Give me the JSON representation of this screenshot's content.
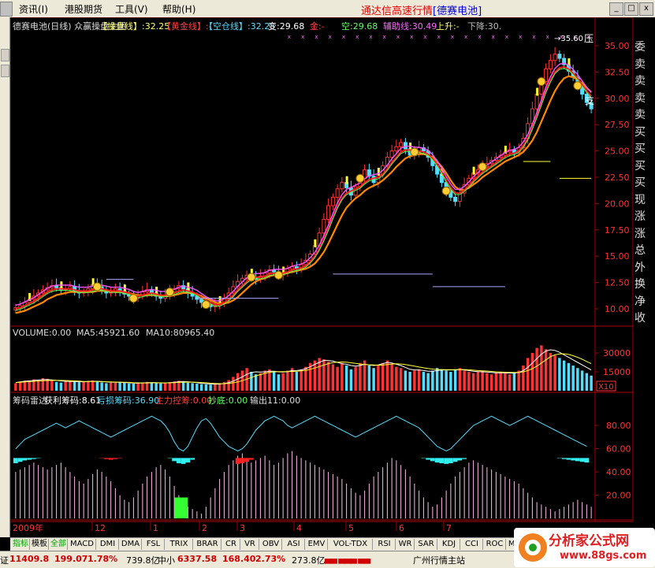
{
  "menu": {
    "items": [
      "资讯(I)",
      "港股期货",
      "工具(V)",
      "帮助(H)"
    ],
    "title_main": "通达信高速行情",
    "title_stock": "[德赛电池]"
  },
  "window_buttons": [
    "_",
    "□",
    "x"
  ],
  "price_panel": {
    "labels": [
      {
        "text": "德赛电池(日线) 众赢操盘主图",
        "color": "#dddddd"
      },
      {
        "text": "【操盘线】:32.25",
        "color": "#ffff66"
      },
      {
        "text": "【黄金线】:-",
        "color": "#ff4040"
      },
      {
        "text": "【空仓线】:32.25",
        "color": "#55ddff"
      },
      {
        "text": "变:29.68",
        "color": "#ffffff"
      },
      {
        "text": "金:-",
        "color": "#ff4040"
      },
      {
        "text": "空:29.68",
        "color": "#66ff66"
      },
      {
        "text": "辅助线:30.49",
        "color": "#ff66ff"
      },
      {
        "text": "上升:-",
        "color": "#ffff66"
      },
      {
        "text": "下降:30.",
        "color": "#bbbbbb"
      }
    ],
    "axis_ticks": [
      "35.00",
      "32.50",
      "30.00",
      "27.50",
      "25.00",
      "22.50",
      "20.00",
      "17.50",
      "15.00",
      "12.50",
      "10.00"
    ],
    "annotations": [
      "35.60",
      "压",
      "支"
    ]
  },
  "right_panel": [
    "委",
    "卖",
    "卖",
    "卖",
    "卖",
    "买",
    "买",
    "买",
    "买",
    "现",
    "涨",
    "涨",
    "总",
    "外",
    "换",
    "净",
    "收"
  ],
  "volume_panel": {
    "labels": [
      {
        "text": "VOLUME:0.00",
        "color": "#dddddd"
      },
      {
        "text": "MA5:45921.60",
        "color": "#dddddd"
      },
      {
        "text": "MA10:80965.40",
        "color": "#dddddd"
      }
    ],
    "axis_ticks": [
      "30000",
      "15000"
    ],
    "unit": "X10"
  },
  "osc_panel": {
    "labels": [
      {
        "text": "筹码雷达",
        "color": "#dddddd"
      },
      {
        "text": "获利筹码:8.61",
        "color": "#ffffff"
      },
      {
        "text": "亏损筹码:36.90",
        "color": "#55ddff"
      },
      {
        "text": "主力控筹:0.00",
        "color": "#ff4040"
      },
      {
        "text": "抄底:0.00",
        "color": "#66ff66"
      },
      {
        "text": "输出11:0.00",
        "color": "#dddddd"
      }
    ],
    "axis_ticks": [
      "80.00",
      "60.00",
      "40.00",
      "20.00"
    ]
  },
  "date_axis": [
    "2009年",
    "12",
    "1",
    "2",
    "3",
    "4",
    "5",
    "6",
    "7"
  ],
  "tabs": [
    "指标",
    "模板",
    "全部",
    "MACD",
    "DMI",
    "DMA",
    "FSL",
    "TRIX",
    "BRAR",
    "CR",
    "VR",
    "OBV",
    "ASI",
    "EMV",
    "VOL-TDX",
    "RSI",
    "WR",
    "SAR",
    "KDJ",
    "CCI",
    "ROC",
    "MTM"
  ],
  "status": {
    "index1_name": "证",
    "index1_value": "11409.8",
    "index1_change": "199.07",
    "index1_pct": "1.78%",
    "index1_amount": "739.8亿",
    "index2_name": "中小",
    "index2_value": "6337.58",
    "index2_change": "168.40",
    "index2_pct": "2.73%",
    "index2_amount": "273.8亿",
    "station": "广州行情主站"
  },
  "watermark": {
    "line1": "分析家公式网",
    "line2": "www.88gs.com"
  },
  "colors": {
    "up": "#ff3333",
    "down": "#55ddff",
    "ma_orange": "#ff8800",
    "ma_red": "#ff2020",
    "ma_magenta": "#ff55ff",
    "ma_green": "#55ff55",
    "accent_yellow": "#ffff33"
  },
  "chart_data": {
    "type": "candlestick",
    "price": {
      "ylim": [
        8.5,
        36.5
      ],
      "ticks": [
        10,
        12.5,
        15,
        17.5,
        20,
        22.5,
        25,
        27.5,
        30,
        32.5,
        35
      ],
      "close": [
        10.1,
        10.3,
        10.6,
        10.9,
        11.2,
        11.5,
        11.8,
        12.0,
        12.2,
        12.0,
        11.8,
        11.9,
        12.1,
        11.7,
        11.5,
        11.6,
        11.9,
        12.3,
        12.1,
        11.8,
        11.5,
        11.6,
        11.9,
        11.7,
        11.4,
        11.2,
        11.0,
        11.3,
        11.6,
        11.8,
        11.5,
        11.2,
        11.0,
        11.3,
        11.6,
        11.9,
        12.2,
        11.9,
        11.5,
        11.2,
        10.9,
        10.6,
        10.4,
        10.2,
        10.3,
        10.6,
        11.0,
        11.5,
        12.1,
        12.6,
        12.9,
        13.2,
        13.0,
        12.8,
        13.1,
        13.4,
        13.7,
        13.5,
        13.2,
        13.4,
        13.8,
        14.0,
        13.8,
        14.2,
        14.6,
        15.2,
        16.0,
        17.2,
        18.5,
        19.8,
        20.6,
        21.4,
        22.0,
        21.5,
        20.8,
        21.6,
        22.4,
        23.2,
        22.6,
        22.0,
        22.8,
        23.6,
        24.4,
        25.0,
        25.4,
        25.8,
        25.2,
        24.6,
        24.9,
        25.3,
        25.0,
        24.4,
        23.6,
        22.8,
        22.0,
        21.2,
        20.6,
        20.2,
        21.0,
        21.8,
        22.4,
        22.9,
        23.2,
        23.5,
        23.8,
        24.1,
        24.4,
        24.6,
        24.9,
        25.1,
        24.8,
        25.3,
        26.2,
        27.6,
        29.0,
        30.4,
        31.6,
        32.8,
        33.6,
        34.2,
        33.8,
        33.2,
        32.6,
        32.0,
        31.2,
        30.4,
        29.6,
        29.0
      ],
      "ma_fast": [
        10.0,
        10.1,
        10.3,
        10.5,
        10.7,
        11.0,
        11.3,
        11.6,
        11.8,
        11.9,
        11.9,
        11.9,
        11.9,
        11.8,
        11.7,
        11.7,
        11.7,
        11.8,
        11.9,
        11.9,
        11.8,
        11.7,
        11.7,
        11.7,
        11.6,
        11.5,
        11.3,
        11.2,
        11.3,
        11.4,
        11.5,
        11.4,
        11.3,
        11.3,
        11.4,
        11.5,
        11.7,
        11.8,
        11.7,
        11.6,
        11.4,
        11.1,
        10.8,
        10.6,
        10.4,
        10.4,
        10.6,
        10.9,
        11.3,
        11.8,
        12.2,
        12.6,
        12.9,
        13.0,
        13.0,
        13.1,
        13.3,
        13.4,
        13.4,
        13.4,
        13.5,
        13.7,
        13.8,
        13.9,
        14.1,
        14.5,
        15.0,
        15.7,
        16.6,
        17.6,
        18.7,
        19.7,
        20.5,
        21.0,
        21.2,
        21.4,
        21.6,
        22.0,
        22.3,
        22.4,
        22.5,
        22.8,
        23.3,
        23.9,
        24.4,
        24.9,
        25.1,
        25.1,
        25.0,
        25.0,
        24.9,
        24.7,
        24.3,
        23.7,
        23.0,
        22.2,
        21.5,
        21.0,
        21.0,
        21.3,
        21.7,
        22.2,
        22.6,
        23.0,
        23.3,
        23.6,
        23.9,
        24.2,
        24.5,
        24.7,
        24.8,
        25.0,
        25.5,
        26.2,
        27.2,
        28.3,
        29.5,
        30.7,
        31.7,
        32.5,
        32.9,
        33.0,
        32.8,
        32.4,
        31.9,
        31.3,
        30.7,
        30.2
      ],
      "ma_slow": [
        9.6,
        9.7,
        9.8,
        10.0,
        10.2,
        10.4,
        10.6,
        10.9,
        11.1,
        11.3,
        11.4,
        11.5,
        11.6,
        11.6,
        11.6,
        11.6,
        11.6,
        11.6,
        11.7,
        11.7,
        11.7,
        11.7,
        11.6,
        11.6,
        11.6,
        11.5,
        11.4,
        11.3,
        11.3,
        11.3,
        11.3,
        11.3,
        11.2,
        11.2,
        11.2,
        11.3,
        11.4,
        11.5,
        11.5,
        11.5,
        11.4,
        11.2,
        11.0,
        10.8,
        10.6,
        10.5,
        10.5,
        10.6,
        10.8,
        11.1,
        11.5,
        11.9,
        12.3,
        12.6,
        12.8,
        12.9,
        13.1,
        13.2,
        13.3,
        13.3,
        13.4,
        13.5,
        13.6,
        13.7,
        13.8,
        14.0,
        14.3,
        14.8,
        15.4,
        16.2,
        17.1,
        18.0,
        18.9,
        19.6,
        20.1,
        20.5,
        20.8,
        21.2,
        21.5,
        21.7,
        21.9,
        22.2,
        22.6,
        23.0,
        23.5,
        23.9,
        24.3,
        24.5,
        24.6,
        24.7,
        24.7,
        24.6,
        24.4,
        24.0,
        23.5,
        22.9,
        22.2,
        21.6,
        21.3,
        21.3,
        21.5,
        21.8,
        22.1,
        22.5,
        22.8,
        23.1,
        23.4,
        23.7,
        24.0,
        24.2,
        24.4,
        24.6,
        24.9,
        25.4,
        26.0,
        26.8,
        27.8,
        28.8,
        29.8,
        30.7,
        31.4,
        31.9,
        32.1,
        32.0,
        31.8,
        31.4,
        31.0,
        30.6
      ]
    },
    "volume": {
      "ylim": [
        0,
        40000
      ],
      "ticks": [
        15000,
        30000
      ],
      "values": [
        6000,
        7000,
        8000,
        7500,
        9000,
        8500,
        10000,
        9500,
        8000,
        7000,
        6500,
        7200,
        8000,
        7600,
        6800,
        7000,
        7800,
        8200,
        7400,
        6600,
        6000,
        6400,
        7000,
        6800,
        6200,
        5800,
        5600,
        6000,
        6600,
        7000,
        6400,
        6000,
        5800,
        6200,
        6800,
        7400,
        8000,
        7200,
        6400,
        6000,
        5600,
        5200,
        5000,
        4800,
        5200,
        6000,
        7000,
        8500,
        11000,
        14000,
        16000,
        18000,
        15000,
        13000,
        14000,
        16000,
        17000,
        15000,
        13000,
        14000,
        16000,
        18000,
        15000,
        17000,
        19000,
        22000,
        24000,
        26000,
        25000,
        23000,
        21000,
        19000,
        22000,
        20000,
        17000,
        19000,
        22000,
        24000,
        20000,
        18000,
        20000,
        22000,
        24000,
        21000,
        19000,
        18000,
        16000,
        15000,
        16000,
        17000,
        15000,
        14000,
        16000,
        18000,
        17000,
        16000,
        15000,
        17000,
        18000,
        16000,
        15000,
        14000,
        15000,
        16000,
        14000,
        13000,
        14000,
        15000,
        14000,
        13000,
        14000,
        16000,
        20000,
        26000,
        30000,
        34000,
        36000,
        33000,
        30000,
        28000,
        26000,
        24000,
        22000,
        20000,
        18000,
        16000,
        14000,
        12000
      ],
      "ma5": [
        6500,
        7000,
        7500,
        7800,
        8200,
        8500,
        8800,
        8800,
        8600,
        8200,
        7800,
        7500,
        7400,
        7300,
        7200,
        7100,
        7300,
        7500,
        7500,
        7300,
        7000,
        6800,
        6800,
        6700,
        6500,
        6300,
        6100,
        6000,
        6200,
        6400,
        6500,
        6400,
        6200,
        6200,
        6400,
        6700,
        7100,
        7300,
        7100,
        6800,
        6400,
        5900,
        5600,
        5300,
        5200,
        5300,
        5700,
        6400,
        7600,
        9300,
        11000,
        13000,
        14500,
        15000,
        14800,
        15000,
        15500,
        15500,
        15000,
        14800,
        15200,
        16000,
        16000,
        16500,
        17500,
        19000,
        21000,
        22500,
        24000,
        24000,
        23500,
        22500,
        21500,
        21000,
        20000,
        19500,
        20000,
        21000,
        20500,
        20000,
        20500,
        21500,
        22500,
        22000,
        21000,
        20000,
        18500,
        17000,
        16500,
        16500,
        16000,
        15500,
        15500,
        16000,
        16500,
        16500,
        16500,
        16500,
        16800,
        16500,
        16000,
        15500,
        15200,
        15000,
        14800,
        14500,
        14200,
        14200,
        14200,
        14000,
        14000,
        14500,
        16000,
        18500,
        22000,
        25500,
        29000,
        31500,
        32500,
        32000,
        30500,
        28500,
        26500,
        24500,
        22500,
        20500,
        18500,
        16500
      ],
      "ma10": [
        6400,
        6700,
        7000,
        7200,
        7500,
        7700,
        8000,
        8100,
        8200,
        8200,
        8200,
        8100,
        8000,
        7800,
        7600,
        7400,
        7300,
        7300,
        7300,
        7200,
        7100,
        7000,
        6900,
        6800,
        6700,
        6600,
        6400,
        6300,
        6200,
        6200,
        6300,
        6300,
        6300,
        6200,
        6300,
        6400,
        6600,
        6800,
        6900,
        6800,
        6700,
        6500,
        6300,
        6000,
        5800,
        5600,
        5600,
        5800,
        6300,
        7000,
        8000,
        9200,
        10500,
        11800,
        12800,
        13800,
        14600,
        15000,
        15200,
        15100,
        15100,
        15300,
        15500,
        15800,
        16200,
        17000,
        18000,
        19200,
        20400,
        21500,
        22300,
        22700,
        22800,
        22600,
        22200,
        21700,
        21200,
        20900,
        20600,
        20500,
        20300,
        20400,
        20800,
        21200,
        21400,
        21200,
        20800,
        20200,
        19500,
        18800,
        18200,
        17600,
        17200,
        16900,
        16800,
        16700,
        16700,
        16700,
        16800,
        16800,
        16600,
        16300,
        16000,
        15800,
        15600,
        15300,
        15000,
        14800,
        14700,
        14600,
        14500,
        14500,
        15000,
        16000,
        17500,
        19500,
        22000,
        24500,
        27000,
        28500,
        29200,
        29300,
        28800,
        27800,
        26500,
        25000,
        23200,
        21500
      ]
    },
    "oscillator": {
      "ylim": [
        0,
        95
      ],
      "ticks": [
        20,
        40,
        60,
        80
      ],
      "line": [
        60,
        64,
        68,
        70,
        72,
        74,
        76,
        78,
        80,
        82,
        80,
        78,
        80,
        82,
        84,
        82,
        80,
        78,
        76,
        74,
        72,
        70,
        72,
        74,
        76,
        78,
        80,
        82,
        84,
        86,
        88,
        86,
        84,
        80,
        74,
        66,
        60,
        58,
        62,
        70,
        78,
        84,
        86,
        82,
        76,
        70,
        66,
        62,
        60,
        58,
        60,
        64,
        70,
        76,
        80,
        84,
        86,
        88,
        86,
        84,
        80,
        78,
        80,
        82,
        84,
        86,
        88,
        86,
        84,
        82,
        80,
        78,
        76,
        74,
        72,
        70,
        72,
        74,
        76,
        78,
        80,
        82,
        84,
        86,
        88,
        86,
        84,
        82,
        80,
        78,
        74,
        70,
        66,
        62,
        60,
        58,
        60,
        64,
        68,
        72,
        76,
        80,
        82,
        84,
        86,
        88,
        86,
        84,
        82,
        80,
        82,
        84,
        86,
        88,
        86,
        84,
        82,
        80,
        78,
        76,
        74,
        72,
        70,
        68,
        66,
        64,
        62
      ],
      "profit": [
        40,
        42,
        44,
        46,
        48,
        46,
        44,
        42,
        44,
        46,
        48,
        44,
        40,
        36,
        32,
        30,
        34,
        38,
        42,
        40,
        36,
        32,
        26,
        20,
        16,
        14,
        18,
        24,
        30,
        36,
        40,
        44,
        46,
        42,
        36,
        28,
        20,
        14,
        10,
        8,
        6,
        4,
        10,
        18,
        26,
        34,
        40,
        46,
        50,
        54,
        56,
        52,
        48,
        50,
        52,
        54,
        50,
        46,
        48,
        52,
        56,
        58,
        54,
        52,
        50,
        48,
        46,
        44,
        42,
        40,
        38,
        36,
        34,
        30,
        26,
        22,
        20,
        24,
        30,
        36,
        40,
        44,
        48,
        52,
        50,
        46,
        42,
        36,
        30,
        24,
        18,
        14,
        10,
        12,
        18,
        24,
        30,
        36,
        40,
        44,
        48,
        50,
        48,
        46,
        44,
        42,
        40,
        38,
        36,
        34,
        32,
        30,
        26,
        22,
        18,
        14,
        12,
        10,
        8,
        6,
        8,
        10,
        12,
        14,
        16,
        14,
        12,
        10
      ],
      "loss": [
        0,
        0,
        0,
        0,
        0,
        0,
        0,
        0,
        0,
        0,
        0,
        0,
        0,
        0,
        0,
        0,
        0,
        0,
        0,
        0,
        0,
        0,
        0,
        0,
        0,
        0,
        0,
        0,
        0,
        0,
        0,
        0,
        0,
        0,
        0,
        0,
        0,
        0,
        0,
        0,
        0,
        0,
        0,
        0,
        0,
        0,
        0,
        0,
        0,
        0,
        0,
        0,
        0,
        0,
        0,
        0,
        0,
        0,
        0,
        0,
        0,
        0,
        0,
        0,
        0,
        0,
        0,
        0,
        0,
        0,
        0,
        0,
        0,
        0,
        0,
        0,
        0,
        0,
        0,
        0,
        0,
        0,
        0,
        0,
        0,
        0,
        0,
        0,
        0,
        0,
        0,
        0,
        0,
        0,
        0,
        0,
        0,
        0,
        0,
        0,
        0,
        0,
        0,
        0,
        0,
        0,
        0,
        0,
        0,
        0,
        0,
        0,
        0,
        0,
        0,
        0,
        0,
        0,
        0,
        0,
        0,
        0,
        0,
        0,
        0,
        0,
        0,
        0
      ]
    }
  }
}
